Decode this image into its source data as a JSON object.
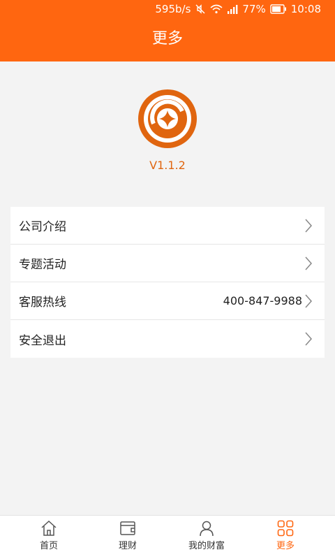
{
  "status_bar": {
    "speed": "595b/s",
    "battery": "77%",
    "time": "10:08"
  },
  "header": {
    "title": "更多"
  },
  "app": {
    "version": "V1.1.2"
  },
  "menu": {
    "items": [
      {
        "label": "公司介绍",
        "value": ""
      },
      {
        "label": "专题活动",
        "value": ""
      },
      {
        "label": "客服热线",
        "value": "400-847-9988"
      },
      {
        "label": "安全退出",
        "value": ""
      }
    ]
  },
  "tabbar": {
    "tabs": [
      {
        "label": "首页",
        "icon": "home-icon"
      },
      {
        "label": "理财",
        "icon": "wallet-icon"
      },
      {
        "label": "我的财富",
        "icon": "user-icon"
      },
      {
        "label": "更多",
        "icon": "grid-icon"
      }
    ],
    "active_index": 3
  },
  "colors": {
    "brand": "#ff6610",
    "background": "#f3f3f3"
  }
}
